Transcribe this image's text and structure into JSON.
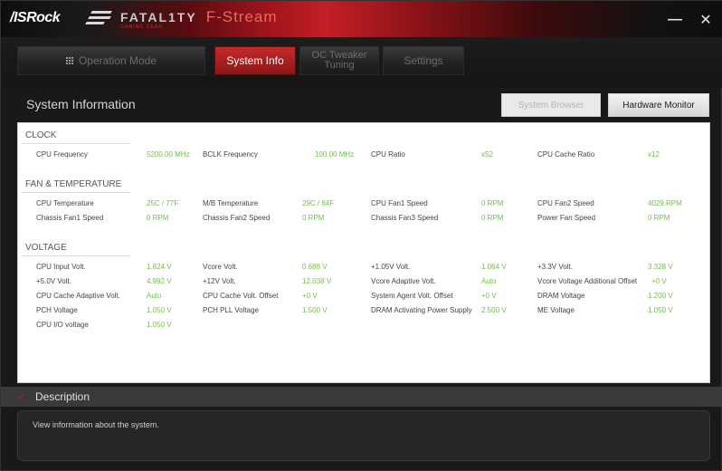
{
  "app": {
    "logo": "/ISRock",
    "brand": "FATAL1TY",
    "brand_sub": "GAMING GEAR",
    "title": "F-Stream",
    "minimize_icon": "minimize-icon",
    "close_icon": "close-icon"
  },
  "tabs": [
    {
      "label": "Operation Mode",
      "active": false,
      "icon": "grid-icon"
    },
    {
      "label": "System Info",
      "active": true
    },
    {
      "label": "OC Tweaker Tuning",
      "active": false
    },
    {
      "label": "Settings",
      "active": false
    }
  ],
  "section": {
    "title": "System Information",
    "system_browser_button": "System Browser",
    "hardware_monitor_button": "Hardware Monitor"
  },
  "clock": {
    "heading": "CLOCK",
    "items": [
      {
        "label": "CPU Frequency",
        "value": "5200.00 MHz"
      },
      {
        "label": "BCLK Frequency",
        "value": "100.00 MHz"
      },
      {
        "label": "CPU Ratio",
        "value": "x52"
      },
      {
        "label": "CPU Cache Ratio",
        "value": "x12"
      }
    ]
  },
  "fan_temp": {
    "heading": "FAN & TEMPERATURE",
    "items": [
      {
        "label": "CPU Temperature",
        "value": "25C / 77F"
      },
      {
        "label": "M/B Temperature",
        "value": "29C / 84F"
      },
      {
        "label": "CPU Fan1 Speed",
        "value": "0 RPM"
      },
      {
        "label": "CPU Fan2 Speed",
        "value": "4029 RPM"
      },
      {
        "label": "Chassis Fan1 Speed",
        "value": "0 RPM"
      },
      {
        "label": "Chassis Fan2 Speed",
        "value": "0 RPM"
      },
      {
        "label": "Chassis Fan3 Speed",
        "value": "0 RPM"
      },
      {
        "label": "Power Fan Speed",
        "value": "0 RPM"
      }
    ]
  },
  "voltage": {
    "heading": "VOLTAGE",
    "items": [
      {
        "label": "CPU Input Volt.",
        "value": "1.824 V"
      },
      {
        "label": "Vcore Volt.",
        "value": "0.688 V"
      },
      {
        "label": "+1.05V Volt.",
        "value": "1.064 V"
      },
      {
        "label": "+3.3V Volt.",
        "value": "3.328 V"
      },
      {
        "label": "+5.0V Volt.",
        "value": "4.992 V"
      },
      {
        "label": "+12V Volt.",
        "value": "12.038 V"
      },
      {
        "label": "Vcore Adaptive Volt.",
        "value": "Auto"
      },
      {
        "label": "Vcore Voltage Additional Offset",
        "value": "+0 V"
      },
      {
        "label": "CPU Cache Adaptive Volt.",
        "value": "Auto"
      },
      {
        "label": "CPU Cache Volt. Offset",
        "value": "+0 V"
      },
      {
        "label": "System Agent Volt. Offset",
        "value": "+0 V"
      },
      {
        "label": "DRAM Voltage",
        "value": "1.200 V"
      },
      {
        "label": "PCH Voltage",
        "value": "1.050 V"
      },
      {
        "label": "PCH PLL Voltage",
        "value": "1.500 V"
      },
      {
        "label": "DRAM Activating Power Supply",
        "value": "2.500 V"
      },
      {
        "label": "ME Voltage",
        "value": "1.050 V"
      },
      {
        "label": "CPU I/O voltage",
        "value": "1.050 V"
      }
    ]
  },
  "description": {
    "title": "Description",
    "text": "View information about the system."
  }
}
